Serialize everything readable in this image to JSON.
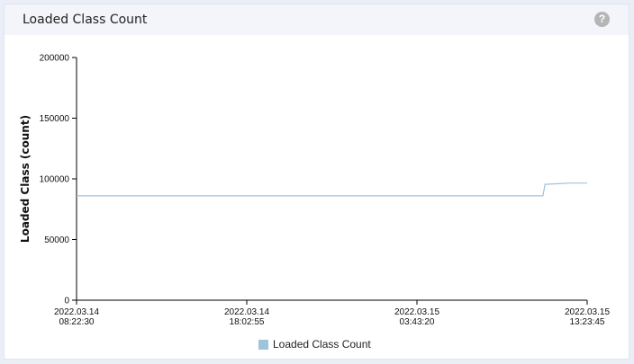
{
  "panel": {
    "title": "Loaded Class Count",
    "help_icon": "question-mark-icon"
  },
  "chart_data": {
    "type": "line",
    "title": "",
    "ylabel": "Loaded Class (count)",
    "xlabel": "",
    "ylim": [
      0,
      200000
    ],
    "yticks": [
      "200000",
      "150000",
      "100000",
      "50000",
      "0"
    ],
    "xticks": [
      {
        "line1": "2022.03.14",
        "line2": "08:22:30"
      },
      {
        "line1": "2022.03.14",
        "line2": "18:02:55"
      },
      {
        "line1": "2022.03.15",
        "line2": "03:43:20"
      },
      {
        "line1": "2022.03.15",
        "line2": "13:23:45"
      }
    ],
    "x_start": "2022-03-14T08:22:30",
    "x_end": "2022-03-15T13:23:45",
    "grid": false,
    "legend_position": "bottom",
    "series": [
      {
        "name": "Loaded Class Count",
        "color": "#9fc2dd",
        "points": [
          {
            "x": "2022-03-14T08:22:30",
            "y": 86000
          },
          {
            "x": "2022-03-15T10:53:00",
            "y": 86000
          },
          {
            "x": "2022-03-15T11:00:00",
            "y": 95500
          },
          {
            "x": "2022-03-15T11:45:00",
            "y": 96000
          },
          {
            "x": "2022-03-15T12:30:00",
            "y": 96500
          },
          {
            "x": "2022-03-15T13:23:45",
            "y": 96500
          }
        ]
      }
    ]
  }
}
